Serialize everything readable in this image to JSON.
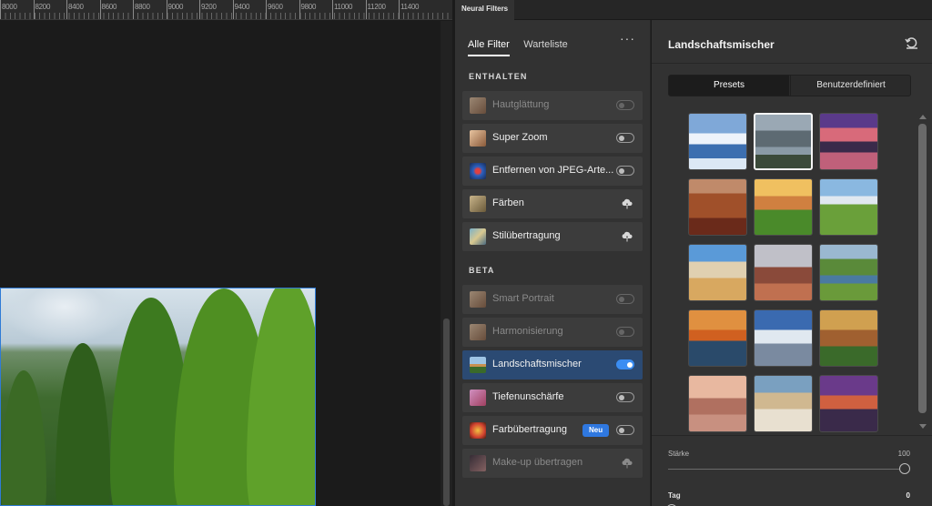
{
  "ruler": {
    "labels": [
      "8000",
      "8200",
      "8400",
      "8600",
      "8800",
      "9000",
      "9200",
      "9400",
      "9600",
      "9800",
      "11000",
      "11200",
      "11400"
    ]
  },
  "panel": {
    "tab_title": "Neural Filters",
    "tabs": [
      {
        "label": "Alle Filter",
        "active": true
      },
      {
        "label": "Warteliste",
        "active": false
      }
    ],
    "more_label": "···",
    "sections": [
      {
        "title": "ENTHALTEN",
        "items": [
          {
            "label": "Hautglättung",
            "control": "toggle",
            "on": false,
            "dim": true,
            "icon": "portrait-thumb"
          },
          {
            "label": "Super Zoom",
            "control": "toggle",
            "on": false,
            "dim": false,
            "icon": "portrait-thumb"
          },
          {
            "label": "Entfernen von JPEG-Arte...",
            "control": "toggle",
            "on": false,
            "dim": false,
            "icon": "butterfly-thumb"
          },
          {
            "label": "Färben",
            "control": "cloud",
            "dim": false,
            "icon": "photo-thumb"
          },
          {
            "label": "Stilübertragung",
            "control": "cloud",
            "dim": false,
            "icon": "art-thumb"
          }
        ]
      },
      {
        "title": "BETA",
        "items": [
          {
            "label": "Smart Portrait",
            "control": "toggle",
            "on": false,
            "dim": true,
            "icon": "portrait-thumb"
          },
          {
            "label": "Harmonisierung",
            "control": "toggle",
            "on": false,
            "dim": true,
            "icon": "portrait-thumb"
          },
          {
            "label": "Landschaftsmischer",
            "control": "toggle",
            "on": true,
            "dim": false,
            "selected": true,
            "icon": "landscape-thumb"
          },
          {
            "label": "Tiefenunschärfe",
            "control": "toggle",
            "on": false,
            "dim": false,
            "icon": "blur-thumb"
          },
          {
            "label": "Farbübertragung",
            "control": "toggle",
            "on": false,
            "dim": false,
            "badge": "Neu",
            "icon": "color-thumb"
          },
          {
            "label": "Make-up übertragen",
            "control": "cloud",
            "dim": true,
            "icon": "makeup-thumb"
          }
        ]
      }
    ]
  },
  "detail": {
    "title": "Landschaftsmischer",
    "segments": [
      {
        "label": "Presets",
        "active": true
      },
      {
        "label": "Benutzerdefiniert",
        "active": false
      }
    ],
    "presets_count_visible": 15,
    "sliders": [
      {
        "label": "Stärke",
        "value": "100",
        "min": 0,
        "max": 100,
        "current": 100
      },
      {
        "label": "Tag",
        "value": "0",
        "min": 0,
        "max": 100,
        "current": 0
      }
    ]
  },
  "colors": {
    "accent": "#3b8df2",
    "selected_row": "#2b4a73",
    "badge": "#2f78e0",
    "panel_bg": "#323232",
    "canvas_bg": "#1b1b1b"
  }
}
